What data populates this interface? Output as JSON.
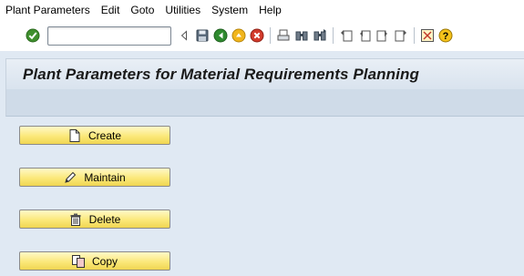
{
  "menubar": {
    "items": [
      "Plant Parameters",
      "Edit",
      "Goto",
      "Utilities",
      "System",
      "Help"
    ]
  },
  "toolbar": {
    "command_value": "",
    "icons": [
      "enter-check-icon",
      "command-field",
      "expand-arrow-icon",
      "save-icon",
      "back-icon",
      "exit-icon",
      "cancel-icon",
      "print-icon",
      "find-icon",
      "find-next-icon",
      "first-page-icon",
      "previous-page-icon",
      "next-page-icon",
      "last-page-icon",
      "layout-menu-icon",
      "help-icon"
    ]
  },
  "title": "Plant Parameters for Material Requirements Planning",
  "buttons": {
    "create": "Create",
    "maintain": "Maintain",
    "delete": "Delete",
    "copy": "Copy"
  },
  "colors": {
    "background": "#e0e9f3",
    "button_yellow": "#fbe87a",
    "title_text": "#1a1a1a"
  }
}
